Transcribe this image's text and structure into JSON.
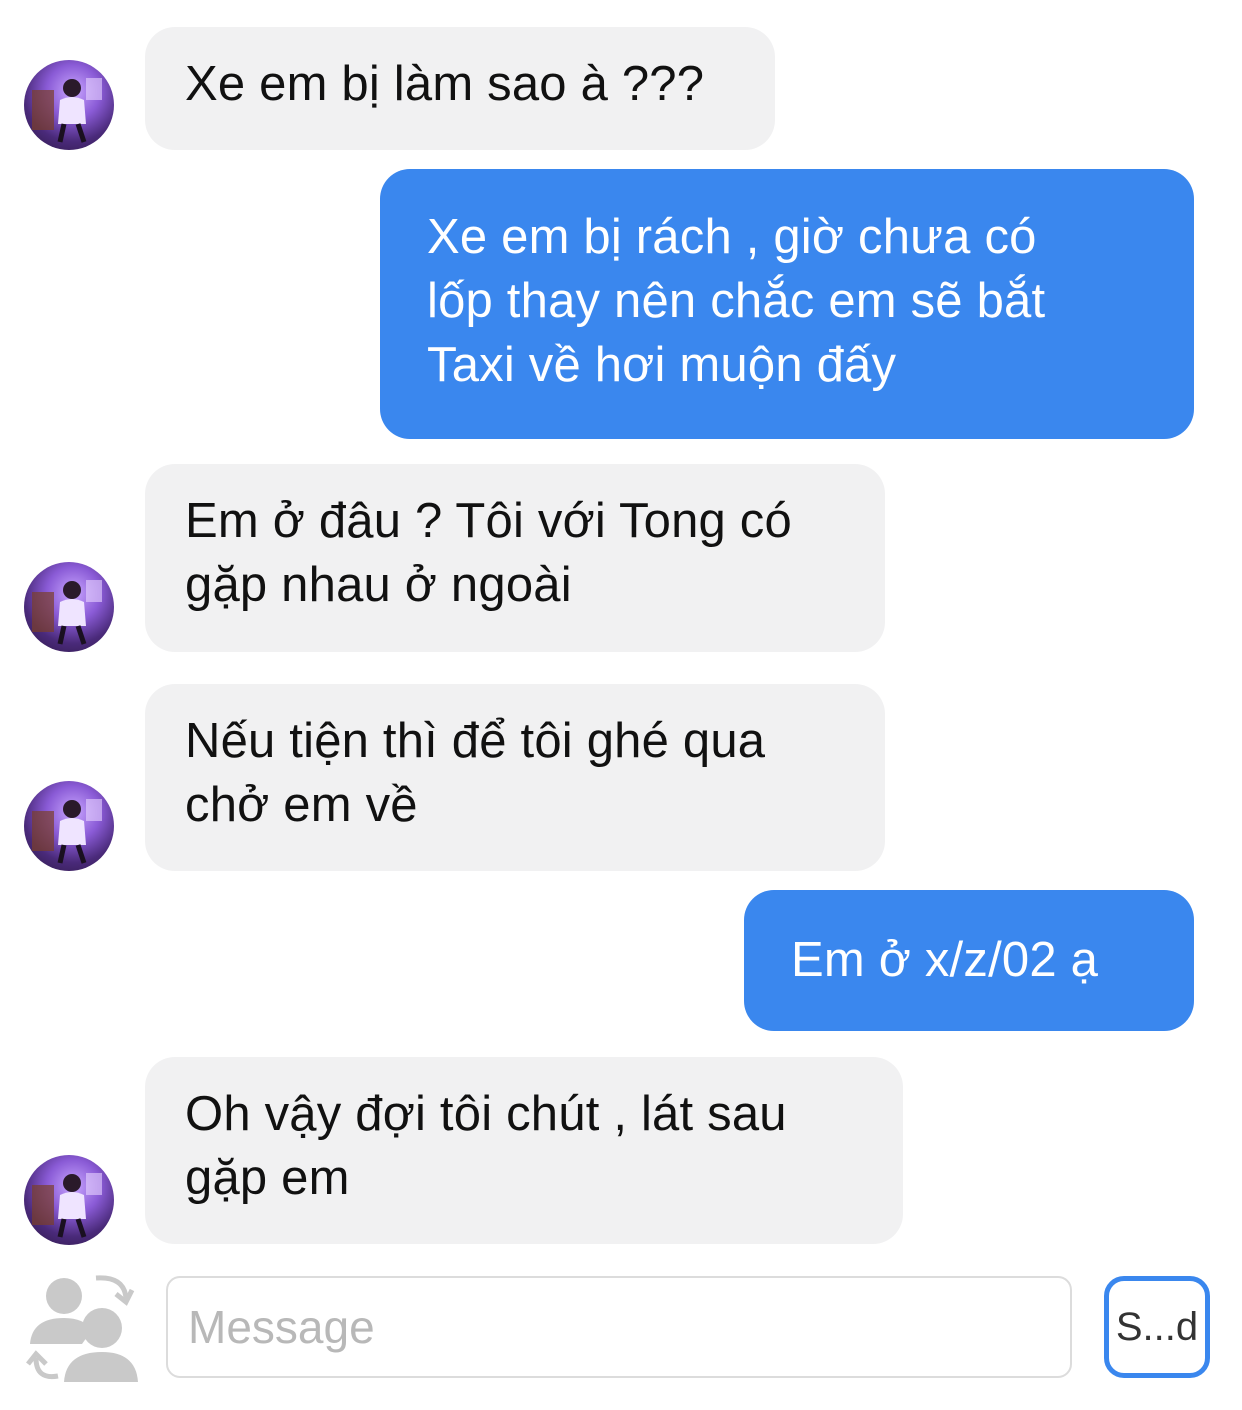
{
  "conversation": {
    "messages": [
      {
        "direction": "incoming",
        "lines": [
          "Xe em bị làm sao à ???"
        ]
      },
      {
        "direction": "outgoing",
        "lines": [
          "Xe em bị rách , giờ chưa có",
          "lốp thay nên chắc em sẽ bắt",
          "Taxi về hơi muộn đấy"
        ]
      },
      {
        "direction": "incoming",
        "lines": [
          "Em ở đâu ? Tôi với Tong có",
          "gặp nhau ở ngoài"
        ]
      },
      {
        "direction": "incoming",
        "lines": [
          "Nếu tiện thì để tôi ghé qua",
          "chở em về"
        ]
      },
      {
        "direction": "outgoing",
        "lines": [
          "Em ở x/z/02 ạ"
        ]
      },
      {
        "direction": "incoming",
        "lines": [
          "Oh vậy đợi tôi chút , lát sau",
          "gặp em"
        ]
      }
    ]
  },
  "composer": {
    "placeholder": "Message",
    "send_label": "S...d",
    "friends_icon": "people-swap-icon"
  },
  "colors": {
    "outgoing_bubble": "#3a87ee",
    "incoming_bubble": "#f1f1f2",
    "send_border": "#3a87ee"
  }
}
